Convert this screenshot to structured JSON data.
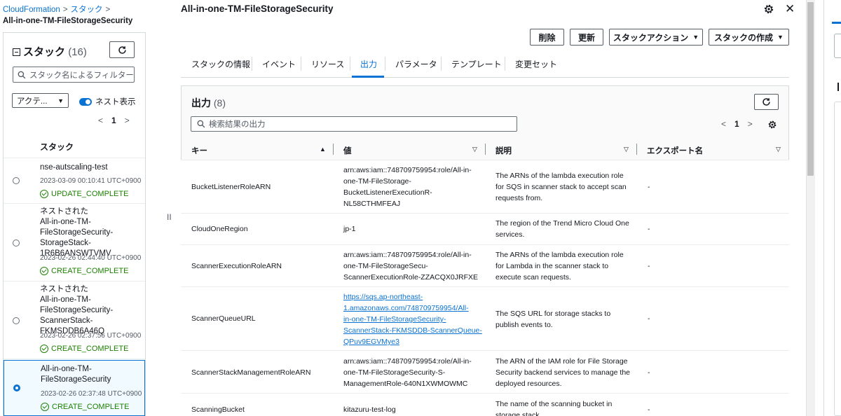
{
  "breadcrumb": {
    "root": "CloudFormation",
    "section": "スタック",
    "current": "All-in-one-TM-FileStorageSecurity"
  },
  "sidebar": {
    "title": "スタック",
    "count": "(16)",
    "filter_placeholder": "スタック名によるフィルター",
    "status_select": "アクテ...",
    "nest_toggle_label": "ネスト表示",
    "page": "1",
    "column_header": "スタック",
    "stacks": [
      {
        "name": "nse-autscaling-test",
        "date": "2023-03-09 00:10:41 UTC+0900",
        "status": "UPDATE_COMPLETE"
      },
      {
        "name": "ネストされた\nAll-in-one-TM-\nFileStorageSecurity-\nStorageStack-1R6B6ANSWTVMV",
        "date": "2023-02-26 02:44:40 UTC+0900",
        "status": "CREATE_COMPLETE"
      },
      {
        "name": "ネストされた\nAll-in-one-TM-\nFileStorageSecurity-\nScannerStack-FKMSDDB6A46Q",
        "date": "2023-02-26 02:37:56 UTC+0900",
        "status": "CREATE_COMPLETE"
      },
      {
        "name": "All-in-one-TM-\nFileStorageSecurity",
        "date": "2023-02-26 02:37:48 UTC+0900",
        "status": "CREATE_COMPLETE"
      }
    ]
  },
  "split_handle": "II",
  "main": {
    "title": "All-in-one-TM-FileStorageSecurity",
    "close": "✕",
    "buttons": {
      "delete": "削除",
      "update": "更新",
      "stack_actions": "スタックアクション",
      "create_stack": "スタックの作成"
    },
    "tabs": [
      "スタックの情報",
      "イベント",
      "リソース",
      "出力",
      "パラメータ",
      "テンプレート",
      "変更セット"
    ]
  },
  "outputs": {
    "title": "出力",
    "count": "(8)",
    "search_placeholder": "検索結果の出力",
    "page": "1",
    "columns": {
      "key": "キー",
      "value": "値",
      "description": "説明",
      "export": "エクスポート名"
    },
    "rows": [
      {
        "key": "BucketListenerRoleARN",
        "value": "arn:aws:iam::748709759954:role/All-in-\none-TM-FileStorage-\nBucketListenerExecutionR-\nNL58CTHMFEAJ",
        "description": "The ARNs of the lambda execution role\nfor SQS in scanner stack to accept scan\nrequests from.",
        "export": "-"
      },
      {
        "key": "CloudOneRegion",
        "value": "jp-1",
        "description": "The region of the Trend Micro Cloud One\nservices.",
        "export": "-"
      },
      {
        "key": "ScannerExecutionRoleARN",
        "value": "arn:aws:iam::748709759954:role/All-in-\none-TM-FileStorageSecu-\nScannerExecutionRole-ZZACQX0JRFXE",
        "description": "The ARNs of the lambda execution role\nfor Lambda in the scanner stack to\nexecute scan requests.",
        "export": "-"
      },
      {
        "key": "ScannerQueueURL",
        "value": "https://sqs.ap-northeast-\n1.amazonaws.com/748709759954/All-\nin-one-TM-FileStorageSecurity-\nScannerStack-FKMSDDB-ScannerQueue-\nQPuv9EGVMye3",
        "description": "The SQS URL for storage stacks to\npublish events to.",
        "export": "-"
      },
      {
        "key": "ScannerStackManagementRoleARN",
        "value": "arn:aws:iam::748709759954:role/All-in-\none-TM-FileStorageSecurity-S-\nManagementRole-640N1XWMOWMC",
        "description": "The ARN of the IAM role for File Storage\nSecurity backend services to manage the\ndeployed resources.",
        "export": "-"
      },
      {
        "key": "ScanningBucket",
        "value": "kitazuru-test-log",
        "description": "The name of the scanning bucket in\nstorage stack.",
        "export": "-"
      }
    ]
  },
  "colors": {
    "accent": "#0972d3",
    "success": "#1d8102",
    "border": "#d5dbdb",
    "text": "#16191f"
  }
}
